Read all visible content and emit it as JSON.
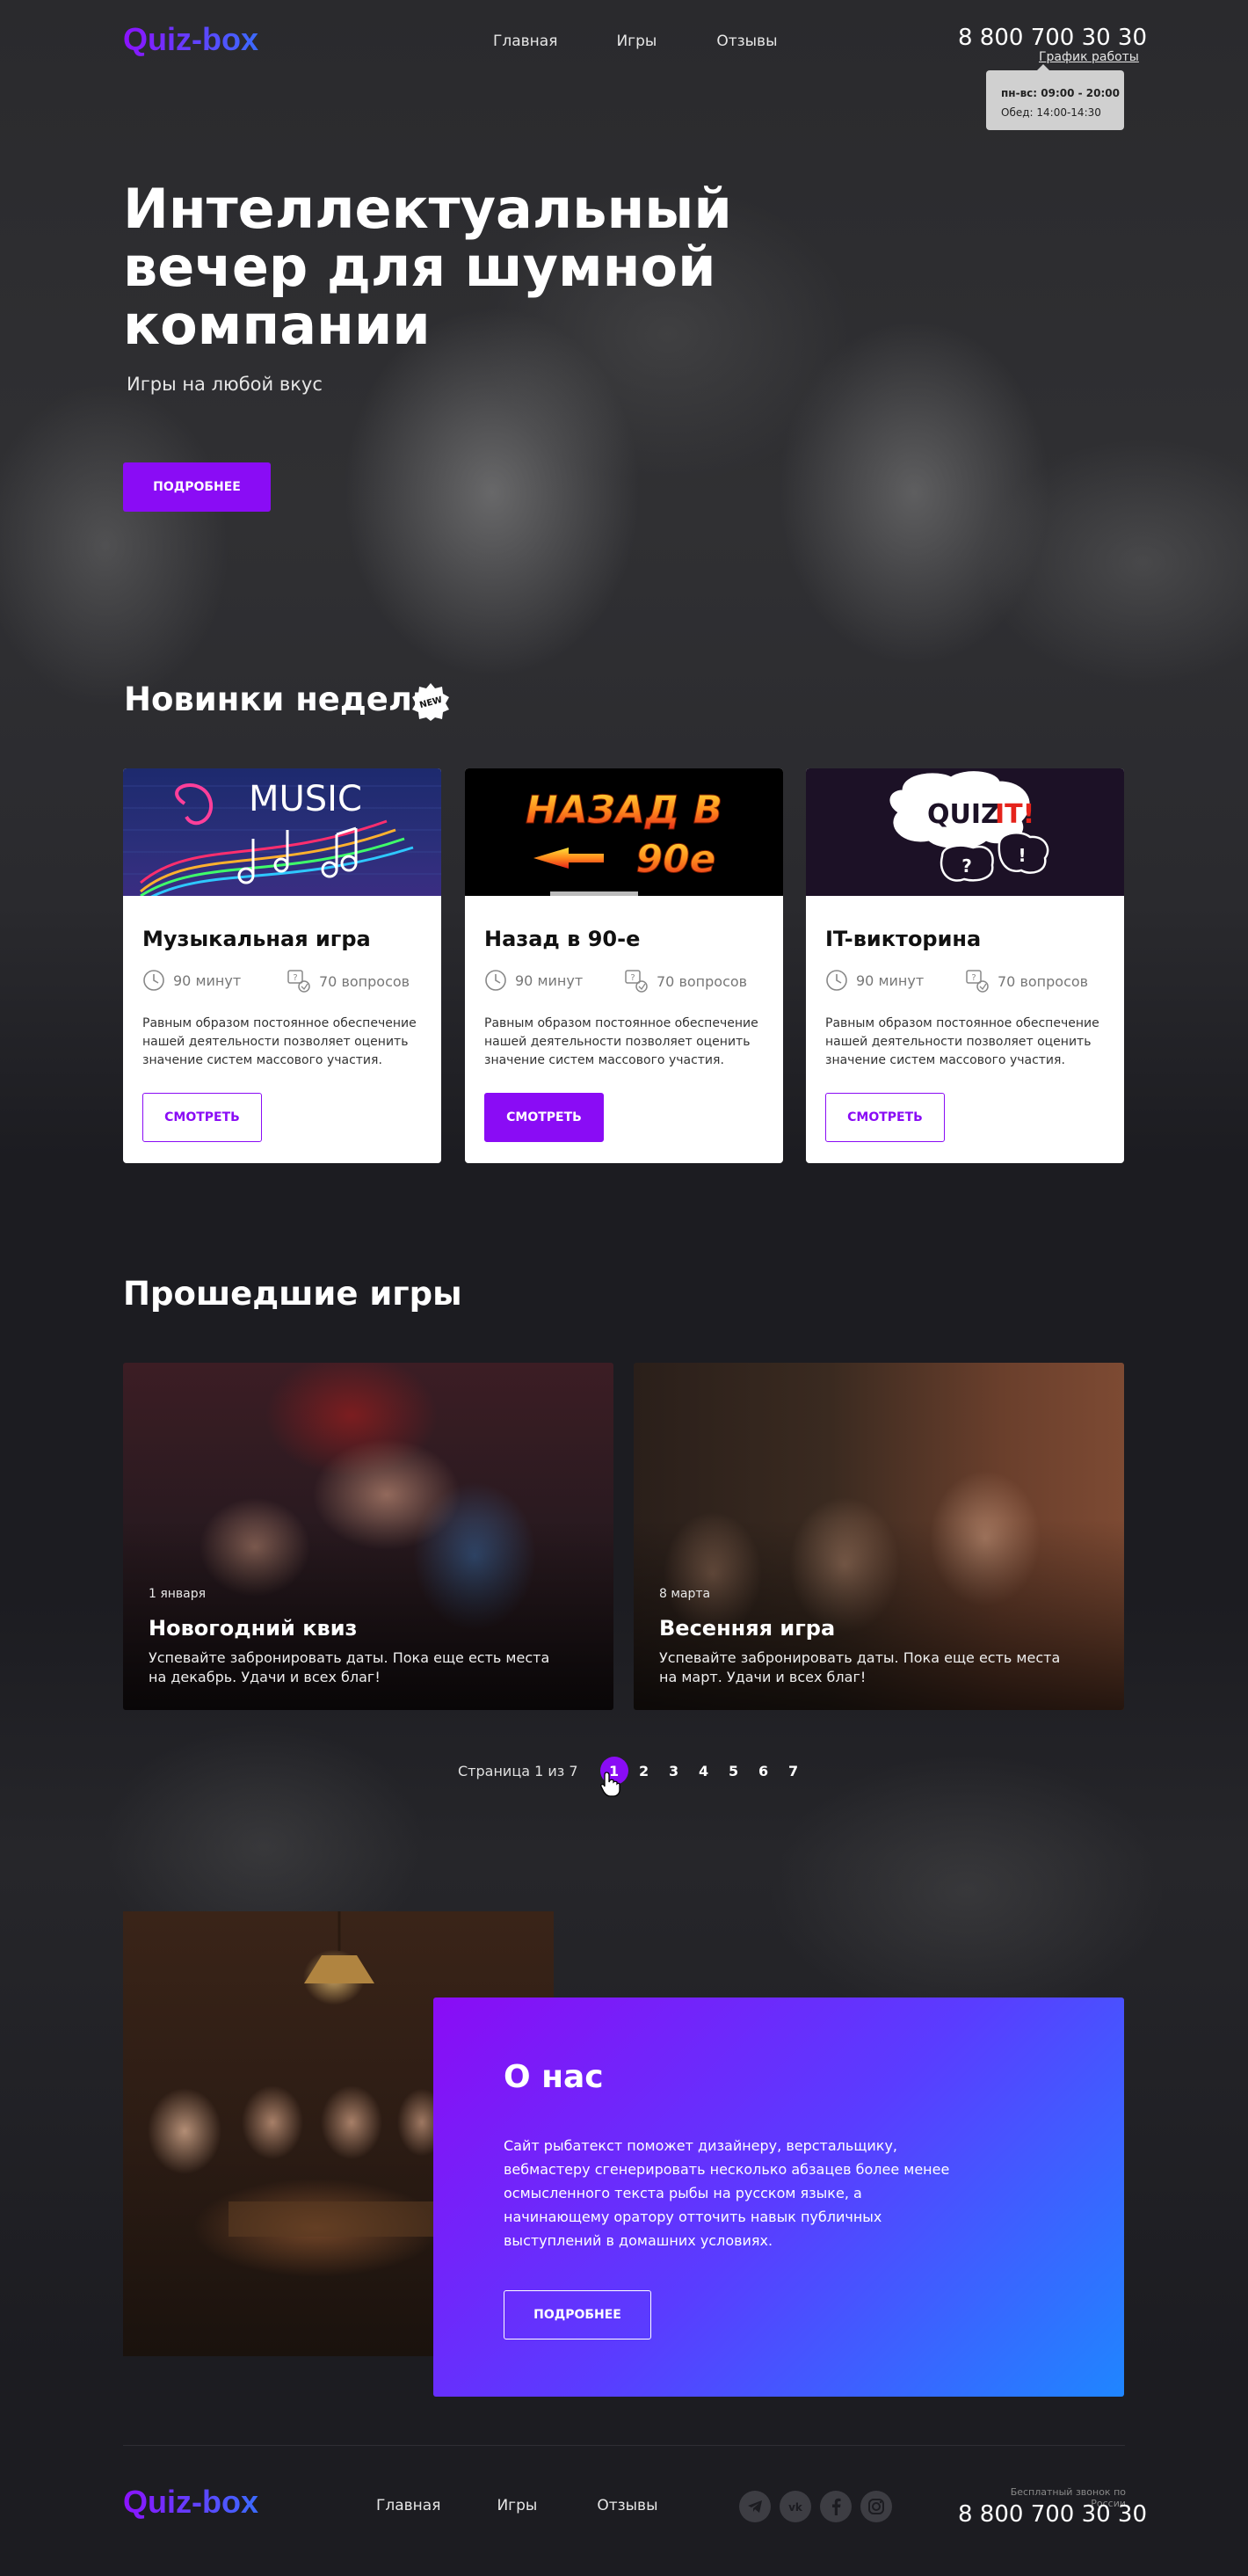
{
  "header": {
    "logo": "Quiz-box",
    "nav": [
      "Главная",
      "Игры",
      "Отзывы"
    ],
    "phone": "8 800 700 30 30",
    "schedule_link": "График работы",
    "schedule_days": "пн-вс: 09:00 - 20:00",
    "schedule_lunch": "Обед: 14:00-14:30"
  },
  "hero": {
    "title": "Интеллектуальный вечер для шумной компании",
    "subtitle": "Игры на любой вкус",
    "button": "ПОДРОБНЕЕ"
  },
  "new_games": {
    "title": "Новинки недели",
    "badge": "NEW",
    "cards": [
      {
        "image_text": "MUSIC",
        "title": "Музыкальная игра",
        "duration": "90 минут",
        "questions": "70 вопросов",
        "desc": "Равным образом постоянное обеспечение нашей деятельности позволяет оценить значение систем массового участия.",
        "button": "СМОТРЕТЬ"
      },
      {
        "image_text_1": "НАЗАД В",
        "image_text_2": "90е",
        "title": "Назад в 90-е",
        "duration": "90 минут",
        "questions": "70 вопросов",
        "desc": "Равным образом постоянное обеспечение нашей деятельности позволяет оценить значение систем массового участия.",
        "button": "СМОТРЕТЬ"
      },
      {
        "image_text_1": "QUIZ",
        "image_text_2": "IT!",
        "title": "IT-викторина",
        "duration": "90 минут",
        "questions": "70 вопросов",
        "desc": "Равным образом постоянное обеспечение нашей деятельности позволяет оценить значение систем массового участия.",
        "button": "СМОТРЕТЬ"
      }
    ]
  },
  "past_games": {
    "title": "Прошедшие игры",
    "items": [
      {
        "date": "1 января",
        "title": "Новогодний квиз",
        "desc": "Успевайте забронировать даты. Пока еще есть места на декабрь. Удачи и всех благ!"
      },
      {
        "date": "8 марта",
        "title": "Весенняя игра",
        "desc": "Успевайте забронировать даты. Пока еще есть места на март. Удачи и всех благ!"
      }
    ],
    "pager_label": "Страница 1 из 7",
    "pages": [
      "1",
      "2",
      "3",
      "4",
      "5",
      "6",
      "7"
    ],
    "current_page": 1
  },
  "about": {
    "title": "О нас",
    "text": "Сайт рыбатекст поможет дизайнеру, верстальщику, вебмастеру сгенерировать несколько абзацев более менее осмысленного текста рыбы на русском языке, а начинающему оратору отточить навык публичных выступлений в домашних условиях.",
    "button": "ПОДРОБНЕЕ"
  },
  "footer": {
    "logo": "Quiz-box",
    "nav": [
      "Главная",
      "Игры",
      "Отзывы"
    ],
    "free_call": "Бесплатный звонок по России",
    "phone": "8 800 700 30 30",
    "socials": [
      "telegram-icon",
      "vk-icon",
      "facebook-icon",
      "instagram-icon"
    ]
  },
  "colors": {
    "accent": "#8a0cf5",
    "gradient_end": "#1f86ff",
    "background": "#1c1c21"
  }
}
